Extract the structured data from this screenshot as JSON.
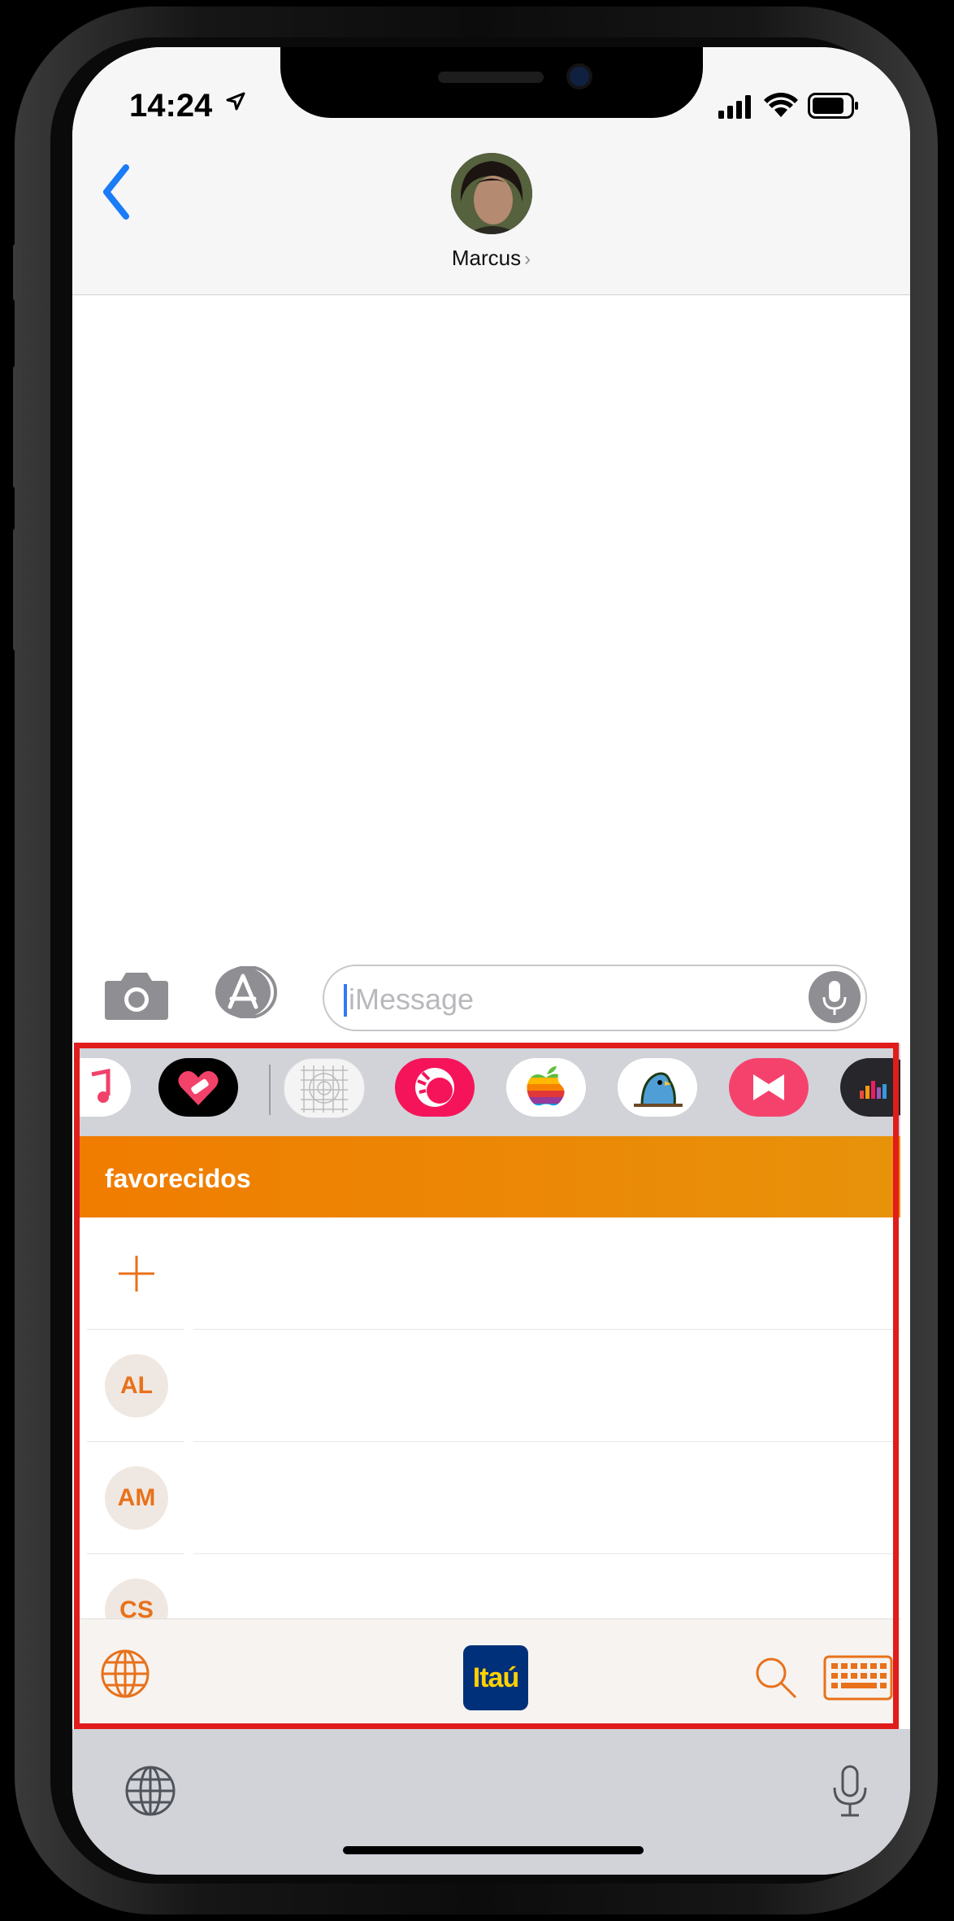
{
  "status_bar": {
    "time": "14:24"
  },
  "conversation": {
    "contact_name": "Marcus",
    "contact_chevron": "›"
  },
  "compose": {
    "placeholder": "iMessage"
  },
  "app_drawer": {
    "apps": [
      "music-app",
      "heart-app",
      "grid-app",
      "swirl-app",
      "apple-app",
      "bird-app",
      "bowtie-app",
      "audio-app"
    ]
  },
  "extension": {
    "header_title": "favorecidos",
    "favorites": [
      {
        "initials": "AL"
      },
      {
        "initials": "AM"
      },
      {
        "initials": "CS"
      }
    ],
    "logo_text": "Itaú"
  },
  "colors": {
    "accent_orange": "#f07c00",
    "ios_blue": "#007aff",
    "highlight_red": "#e01c1c",
    "itau_blue": "#00307a",
    "itau_yellow": "#ffd000"
  }
}
